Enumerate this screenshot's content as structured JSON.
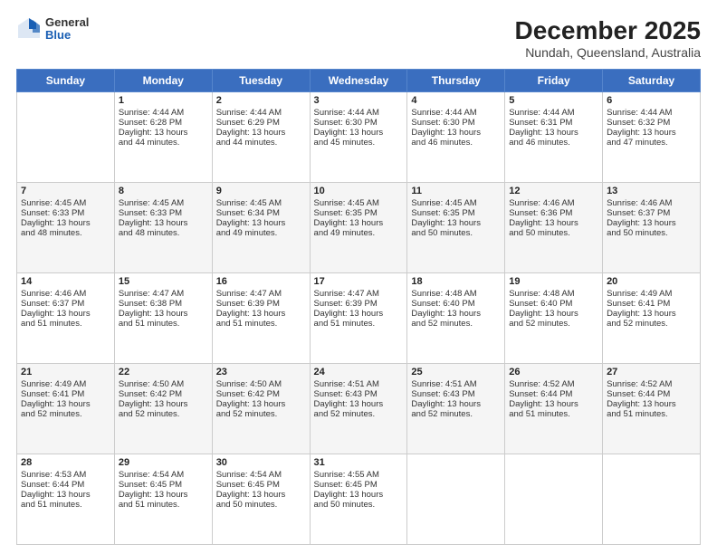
{
  "logo": {
    "general": "General",
    "blue": "Blue"
  },
  "header": {
    "title": "December 2025",
    "subtitle": "Nundah, Queensland, Australia"
  },
  "days_of_week": [
    "Sunday",
    "Monday",
    "Tuesday",
    "Wednesday",
    "Thursday",
    "Friday",
    "Saturday"
  ],
  "weeks": [
    [
      {
        "day": "",
        "content": ""
      },
      {
        "day": "1",
        "content": "Sunrise: 4:44 AM\nSunset: 6:28 PM\nDaylight: 13 hours\nand 44 minutes."
      },
      {
        "day": "2",
        "content": "Sunrise: 4:44 AM\nSunset: 6:29 PM\nDaylight: 13 hours\nand 44 minutes."
      },
      {
        "day": "3",
        "content": "Sunrise: 4:44 AM\nSunset: 6:30 PM\nDaylight: 13 hours\nand 45 minutes."
      },
      {
        "day": "4",
        "content": "Sunrise: 4:44 AM\nSunset: 6:30 PM\nDaylight: 13 hours\nand 46 minutes."
      },
      {
        "day": "5",
        "content": "Sunrise: 4:44 AM\nSunset: 6:31 PM\nDaylight: 13 hours\nand 46 minutes."
      },
      {
        "day": "6",
        "content": "Sunrise: 4:44 AM\nSunset: 6:32 PM\nDaylight: 13 hours\nand 47 minutes."
      }
    ],
    [
      {
        "day": "7",
        "content": "Sunrise: 4:45 AM\nSunset: 6:33 PM\nDaylight: 13 hours\nand 48 minutes."
      },
      {
        "day": "8",
        "content": "Sunrise: 4:45 AM\nSunset: 6:33 PM\nDaylight: 13 hours\nand 48 minutes."
      },
      {
        "day": "9",
        "content": "Sunrise: 4:45 AM\nSunset: 6:34 PM\nDaylight: 13 hours\nand 49 minutes."
      },
      {
        "day": "10",
        "content": "Sunrise: 4:45 AM\nSunset: 6:35 PM\nDaylight: 13 hours\nand 49 minutes."
      },
      {
        "day": "11",
        "content": "Sunrise: 4:45 AM\nSunset: 6:35 PM\nDaylight: 13 hours\nand 50 minutes."
      },
      {
        "day": "12",
        "content": "Sunrise: 4:46 AM\nSunset: 6:36 PM\nDaylight: 13 hours\nand 50 minutes."
      },
      {
        "day": "13",
        "content": "Sunrise: 4:46 AM\nSunset: 6:37 PM\nDaylight: 13 hours\nand 50 minutes."
      }
    ],
    [
      {
        "day": "14",
        "content": "Sunrise: 4:46 AM\nSunset: 6:37 PM\nDaylight: 13 hours\nand 51 minutes."
      },
      {
        "day": "15",
        "content": "Sunrise: 4:47 AM\nSunset: 6:38 PM\nDaylight: 13 hours\nand 51 minutes."
      },
      {
        "day": "16",
        "content": "Sunrise: 4:47 AM\nSunset: 6:39 PM\nDaylight: 13 hours\nand 51 minutes."
      },
      {
        "day": "17",
        "content": "Sunrise: 4:47 AM\nSunset: 6:39 PM\nDaylight: 13 hours\nand 51 minutes."
      },
      {
        "day": "18",
        "content": "Sunrise: 4:48 AM\nSunset: 6:40 PM\nDaylight: 13 hours\nand 52 minutes."
      },
      {
        "day": "19",
        "content": "Sunrise: 4:48 AM\nSunset: 6:40 PM\nDaylight: 13 hours\nand 52 minutes."
      },
      {
        "day": "20",
        "content": "Sunrise: 4:49 AM\nSunset: 6:41 PM\nDaylight: 13 hours\nand 52 minutes."
      }
    ],
    [
      {
        "day": "21",
        "content": "Sunrise: 4:49 AM\nSunset: 6:41 PM\nDaylight: 13 hours\nand 52 minutes."
      },
      {
        "day": "22",
        "content": "Sunrise: 4:50 AM\nSunset: 6:42 PM\nDaylight: 13 hours\nand 52 minutes."
      },
      {
        "day": "23",
        "content": "Sunrise: 4:50 AM\nSunset: 6:42 PM\nDaylight: 13 hours\nand 52 minutes."
      },
      {
        "day": "24",
        "content": "Sunrise: 4:51 AM\nSunset: 6:43 PM\nDaylight: 13 hours\nand 52 minutes."
      },
      {
        "day": "25",
        "content": "Sunrise: 4:51 AM\nSunset: 6:43 PM\nDaylight: 13 hours\nand 52 minutes."
      },
      {
        "day": "26",
        "content": "Sunrise: 4:52 AM\nSunset: 6:44 PM\nDaylight: 13 hours\nand 51 minutes."
      },
      {
        "day": "27",
        "content": "Sunrise: 4:52 AM\nSunset: 6:44 PM\nDaylight: 13 hours\nand 51 minutes."
      }
    ],
    [
      {
        "day": "28",
        "content": "Sunrise: 4:53 AM\nSunset: 6:44 PM\nDaylight: 13 hours\nand 51 minutes."
      },
      {
        "day": "29",
        "content": "Sunrise: 4:54 AM\nSunset: 6:45 PM\nDaylight: 13 hours\nand 51 minutes."
      },
      {
        "day": "30",
        "content": "Sunrise: 4:54 AM\nSunset: 6:45 PM\nDaylight: 13 hours\nand 50 minutes."
      },
      {
        "day": "31",
        "content": "Sunrise: 4:55 AM\nSunset: 6:45 PM\nDaylight: 13 hours\nand 50 minutes."
      },
      {
        "day": "",
        "content": ""
      },
      {
        "day": "",
        "content": ""
      },
      {
        "day": "",
        "content": ""
      }
    ]
  ]
}
